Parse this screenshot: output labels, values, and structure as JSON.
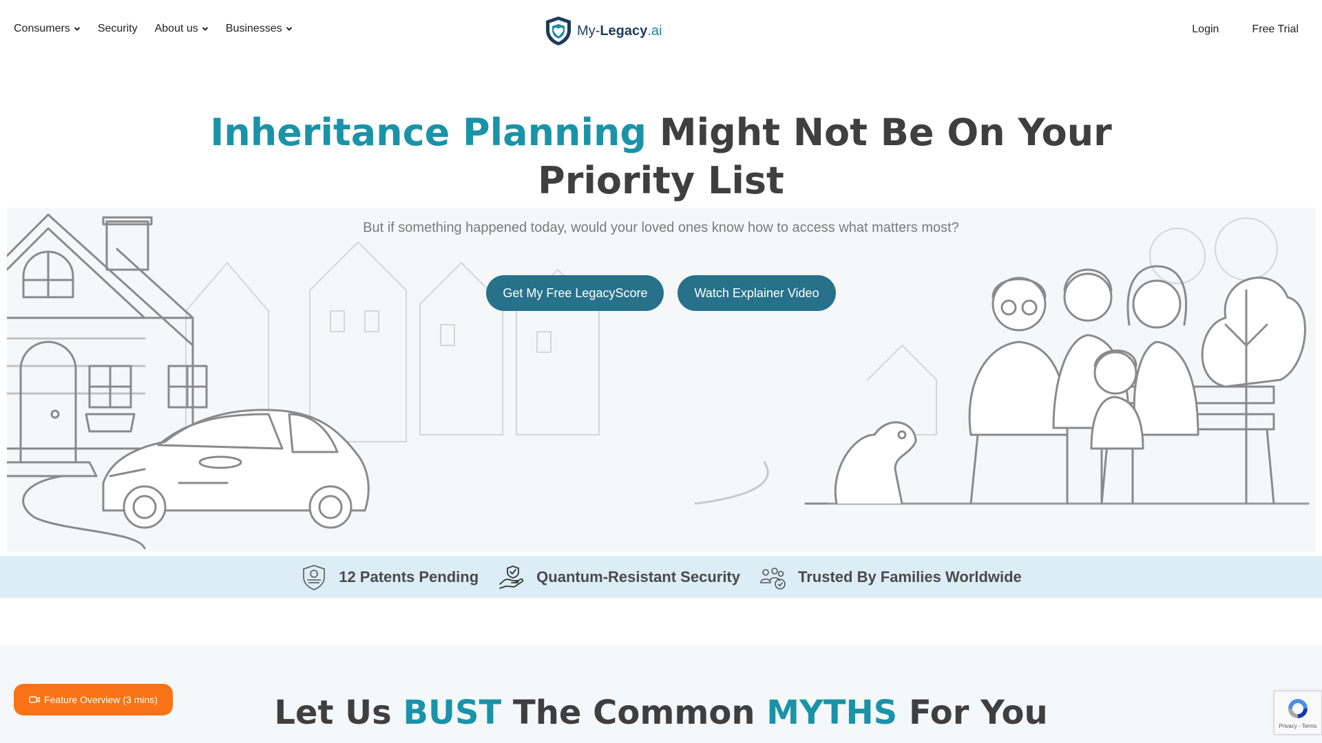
{
  "nav": {
    "left": [
      {
        "label": "Consumers",
        "dropdown": true
      },
      {
        "label": "Security",
        "dropdown": false
      },
      {
        "label": "About us",
        "dropdown": true
      },
      {
        "label": "Businesses",
        "dropdown": true
      }
    ],
    "logo": {
      "prefix": "My-",
      "bold": "Legacy",
      "suffix": ".ai"
    },
    "right": [
      {
        "label": "Login"
      },
      {
        "label": "Free Trial"
      }
    ]
  },
  "hero": {
    "title_accent": "Inheritance Planning",
    "title_rest": " Might Not Be On Your Priority List",
    "subtitle": "But if something happened today, would your loved ones know how to access what matters most?",
    "primary_button": "Get My Free LegacyScore",
    "secondary_button": "Watch Explainer Video"
  },
  "trust": [
    {
      "icon": "patent-badge-icon",
      "label": "12 Patents Pending"
    },
    {
      "icon": "hand-shield-icon",
      "label": "Quantum-Resistant Security"
    },
    {
      "icon": "family-check-icon",
      "label": "Trusted By Families Worldwide"
    }
  ],
  "myths": {
    "part1": "Let Us ",
    "accent1": "BUST",
    "part2": " The Common ",
    "accent2": "MYTHS",
    "part3": " For You"
  },
  "feature_button": "Feature Overview (3 mins)",
  "recaptcha": {
    "text": "Privacy - Terms"
  },
  "colors": {
    "accent": "#1a93a8",
    "button": "#27728a",
    "trust_bar": "#dcedf6",
    "feature_button": "#f97316"
  }
}
